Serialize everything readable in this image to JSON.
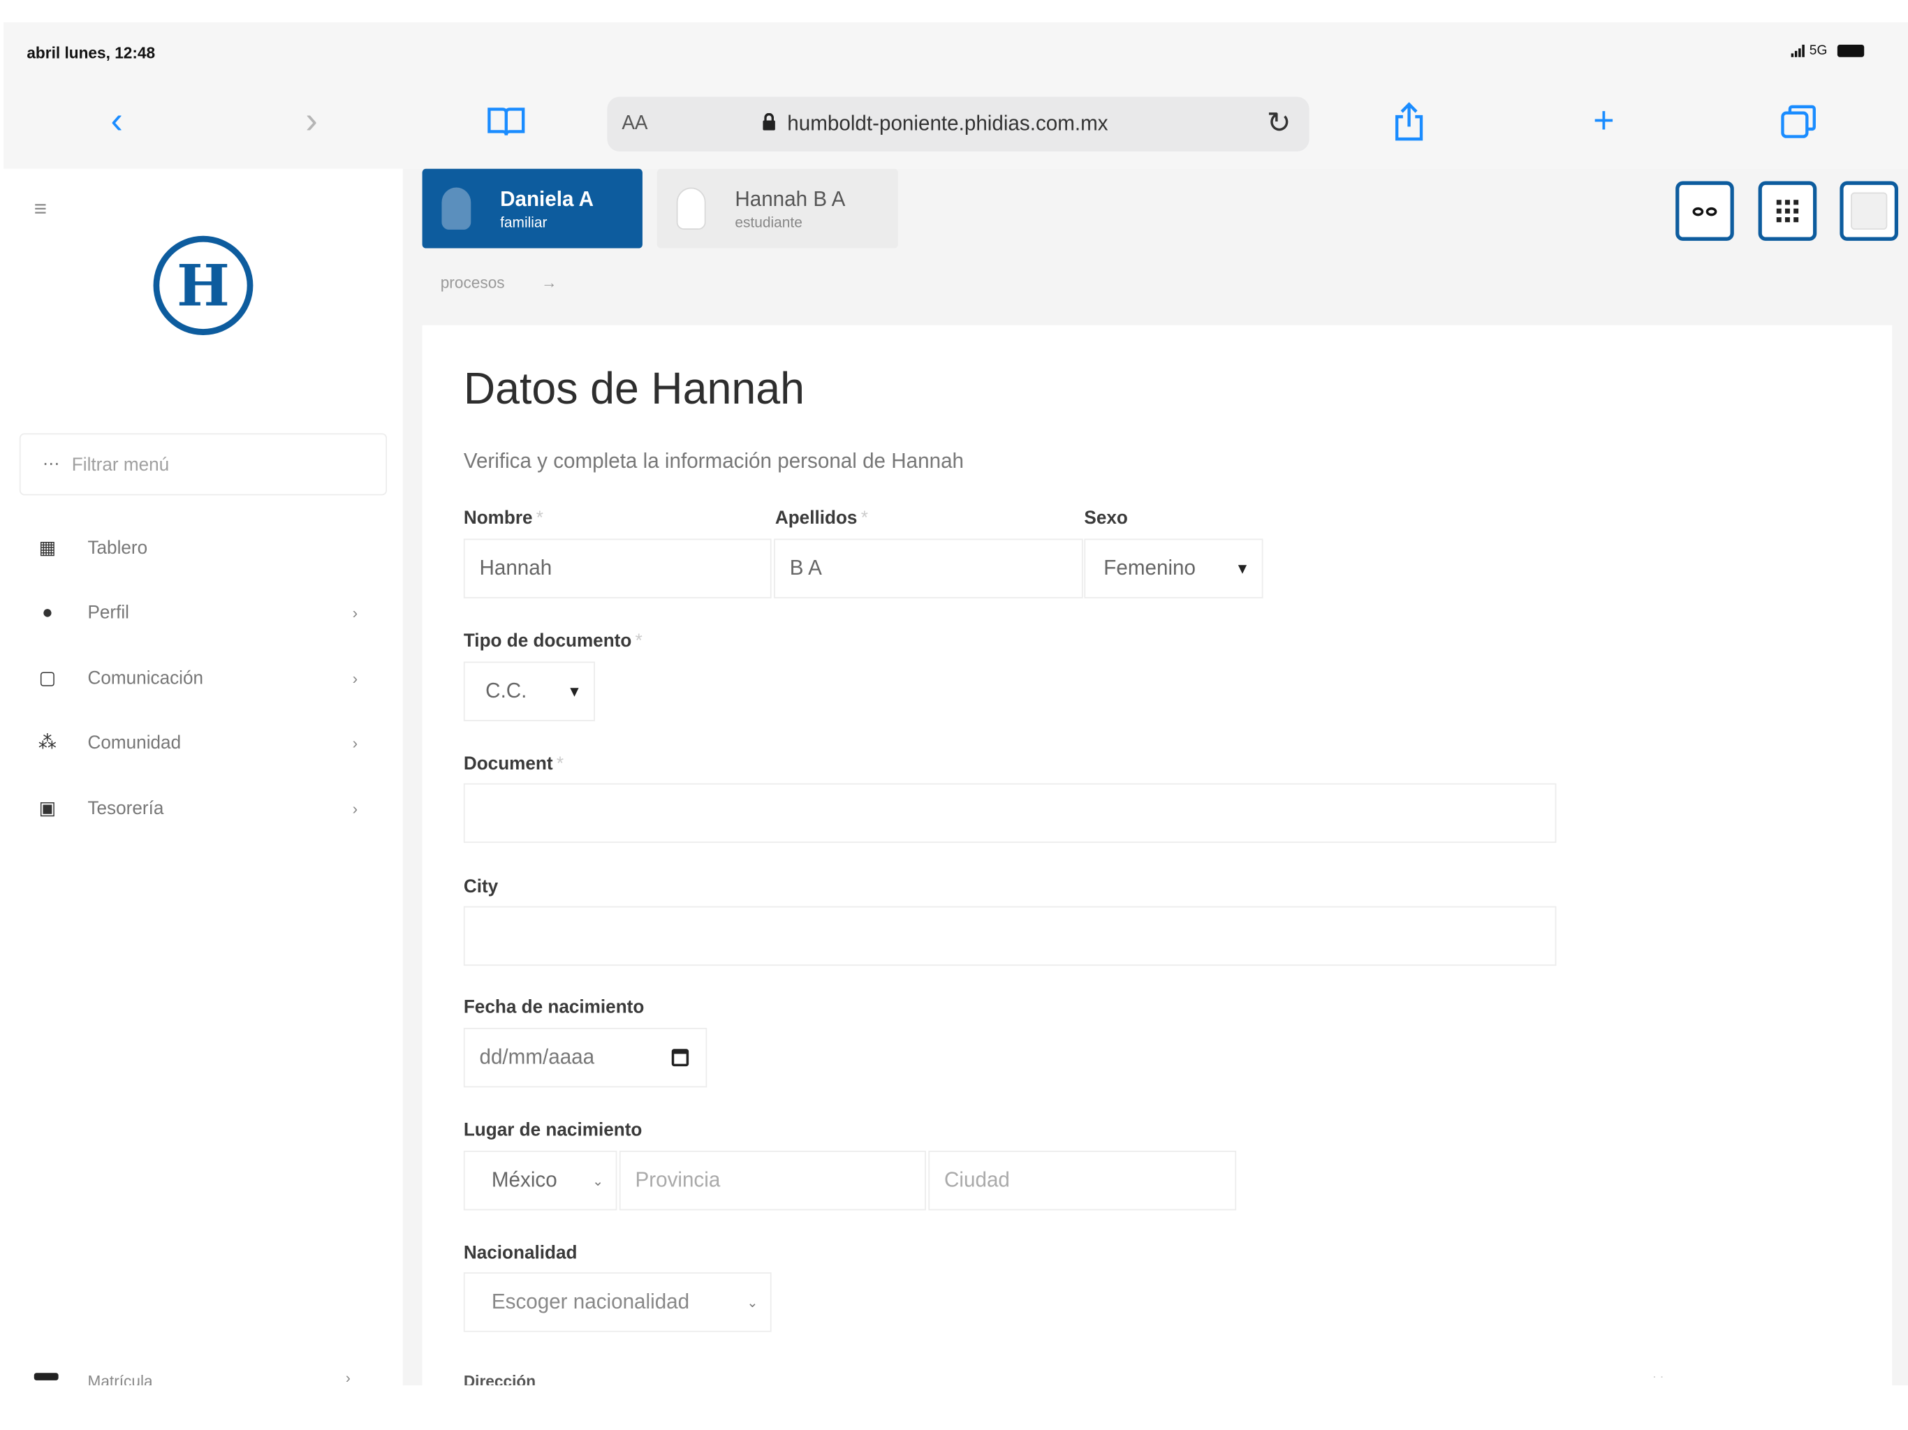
{
  "status_bar": {
    "time": "abril lunes, 12:48",
    "network": "5G"
  },
  "browser": {
    "back_icon": "chevron-left-icon",
    "forward_icon": "chevron-right-icon",
    "reader_icon": "book-icon",
    "text_size_label": "AA",
    "url": "humboldt-poniente.phidias.com.mx",
    "reload_icon": "reload-icon",
    "share_icon": "share-icon",
    "new_tab_icon": "plus-icon",
    "tabs_icon": "tabs-icon",
    "accent_color": "#1a8cff"
  },
  "sidebar": {
    "logo_letter": "H",
    "brand_color": "#0d5c9e",
    "filter_placeholder": "Filtrar menú",
    "items": [
      {
        "label": "Tablero",
        "icon": "dashboard-icon",
        "has_chevron": false
      },
      {
        "label": "Perfil",
        "icon": "user-icon",
        "has_chevron": true
      },
      {
        "label": "Comunicación",
        "icon": "inbox-icon",
        "has_chevron": true
      },
      {
        "label": "Comunidad",
        "icon": "community-icon",
        "has_chevron": true
      },
      {
        "label": "Tesorería",
        "icon": "money-icon",
        "has_chevron": true
      }
    ],
    "bottom_item": {
      "label": "Matrícula",
      "icon": "graduation-icon"
    }
  },
  "header": {
    "profiles": [
      {
        "name": "Daniela A",
        "role": "familiar",
        "active": true
      },
      {
        "name": "Hannah B A",
        "role": "estudiante",
        "active": false
      }
    ],
    "tools": [
      "glasses-icon",
      "apps-grid-icon",
      "avatar-icon"
    ]
  },
  "breadcrumb": {
    "items": [
      "procesos",
      "→"
    ]
  },
  "form": {
    "title": "Datos de Hannah",
    "subtitle": "Verifica y completa la información personal de Hannah",
    "nombre": {
      "label": "Nombre",
      "value": "Hannah"
    },
    "apellidos": {
      "label": "Apellidos",
      "value": "B A"
    },
    "sexo": {
      "label": "Sexo",
      "value": "Femenino"
    },
    "tipo_documento": {
      "label": "Tipo de documento",
      "value": "C.C."
    },
    "document": {
      "label": "Document",
      "value": ""
    },
    "city": {
      "label": "City",
      "value": ""
    },
    "fecha_nacimiento": {
      "label": "Fecha de nacimiento",
      "placeholder": "dd/mm/aaaa"
    },
    "lugar_nacimiento": {
      "label": "Lugar de nacimiento",
      "pais": "México",
      "provincia_placeholder": "Provincia",
      "ciudad_placeholder": "Ciudad"
    },
    "nacionalidad": {
      "label": "Nacionalidad",
      "placeholder": "Escoger nacionalidad"
    },
    "direccion": {
      "label": "Dirección"
    },
    "required_mark": "*"
  }
}
